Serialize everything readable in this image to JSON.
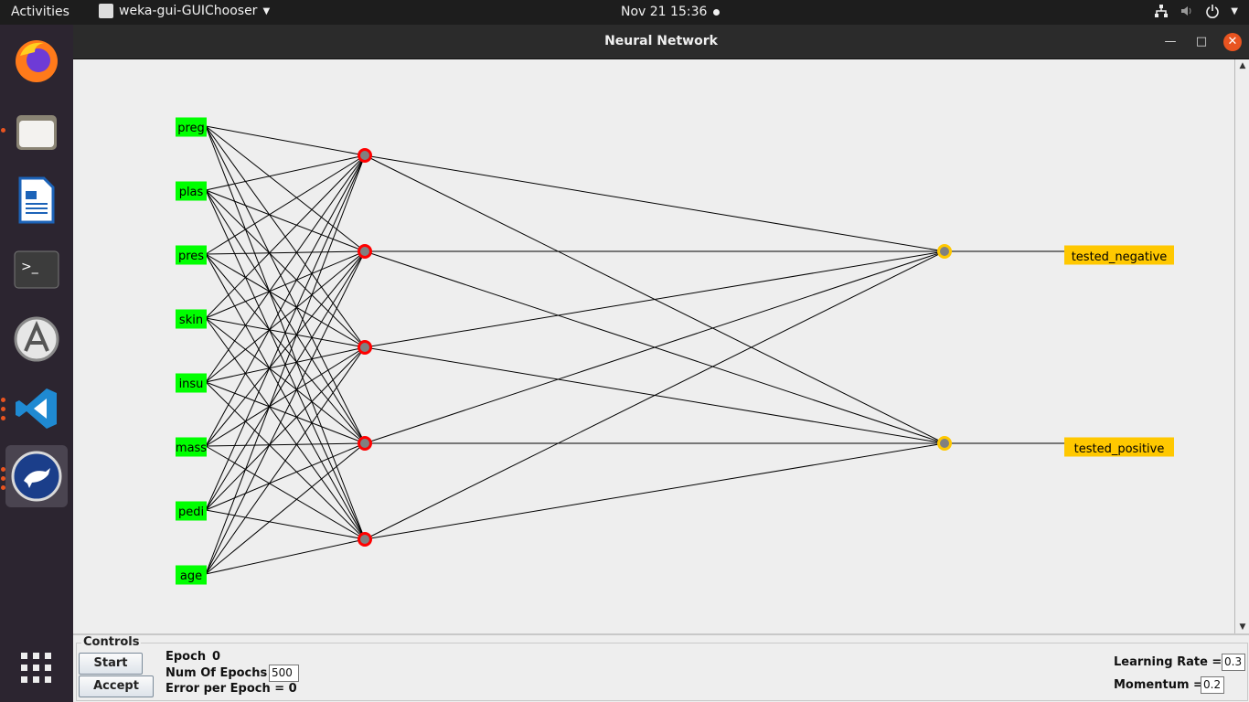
{
  "topbar": {
    "activities": "Activities",
    "app_menu": "weka-gui-GUIChooser",
    "clock": "Nov 21  15:36",
    "tray_icons": [
      "network-icon",
      "volume-icon",
      "power-icon",
      "chevron-down-icon"
    ]
  },
  "dock": {
    "apps": [
      "firefox-icon",
      "files-icon",
      "libreoffice-writer-icon",
      "terminal-icon",
      "software-center-icon",
      "vscode-icon",
      "weka-icon",
      "app-grid-icon"
    ]
  },
  "window": {
    "title": "Neural Network"
  },
  "network": {
    "inputs": [
      "preg",
      "plas",
      "pres",
      "skin",
      "insu",
      "mass",
      "pedi",
      "age"
    ],
    "hidden_count": 5,
    "output_count": 2,
    "classes": [
      "tested_negative",
      "tested_positive"
    ],
    "colors": {
      "input_fill": "#00ff00",
      "hidden_ring": "#ff0000",
      "node_core": "#808080",
      "output_ring": "#ffc800",
      "class_fill": "#ffc800"
    }
  },
  "controls": {
    "legend": "Controls",
    "start_label": "Start",
    "accept_label": "Accept",
    "epoch_label": "Epoch",
    "epoch_value": "0",
    "num_epochs_label": "Num Of Epochs",
    "num_epochs_value": "500",
    "error_label": "Error per Epoch = 0",
    "learning_rate_label": "Learning Rate =",
    "learning_rate_value": "0.3",
    "momentum_label": "Momentum =",
    "momentum_value": "0.2"
  }
}
